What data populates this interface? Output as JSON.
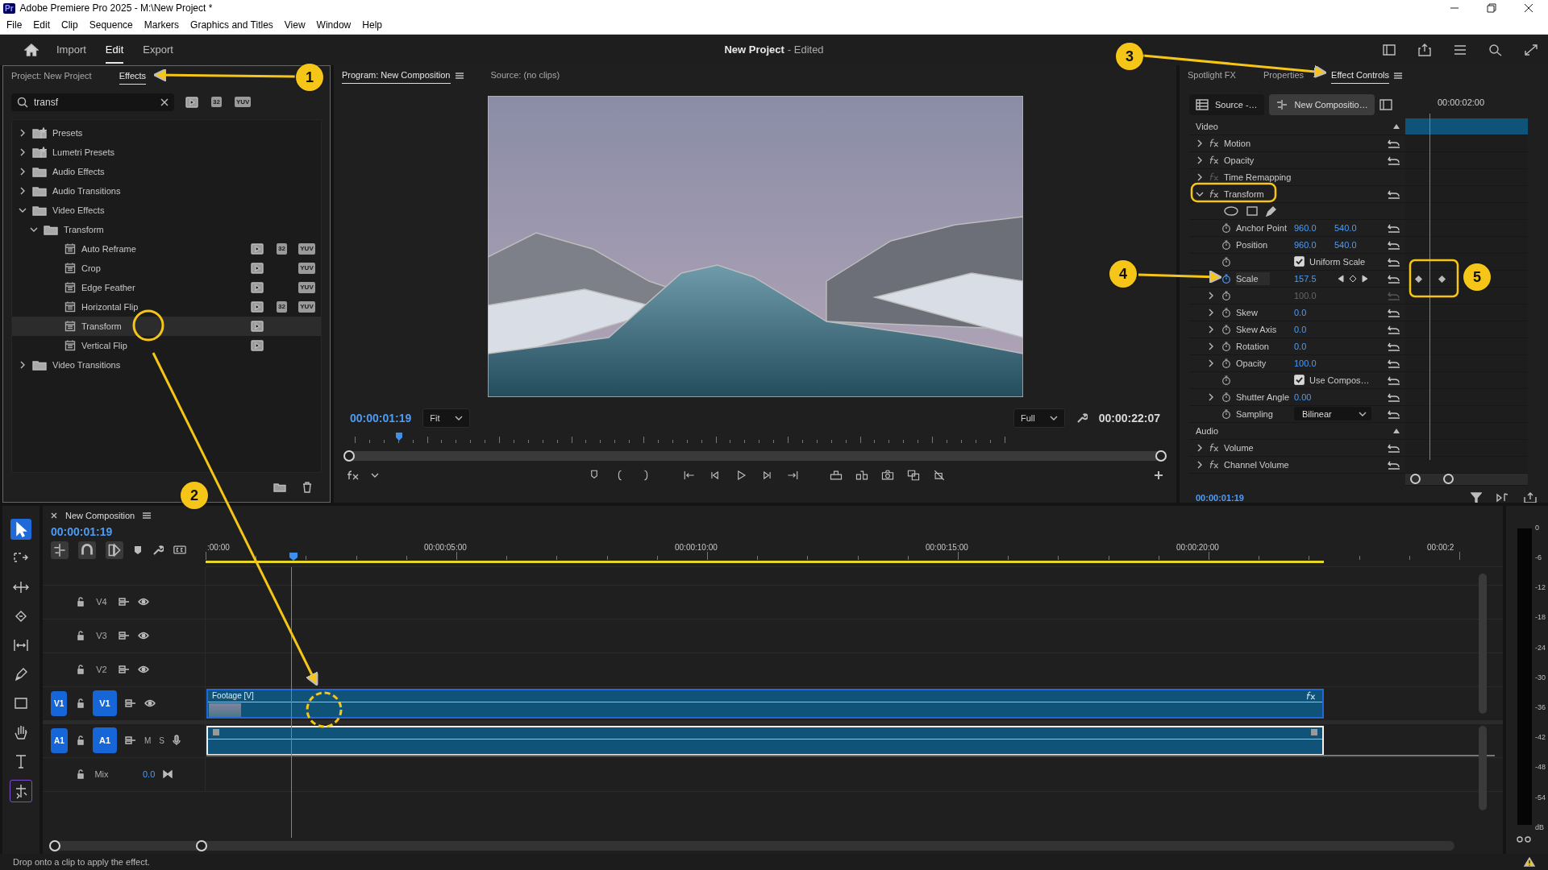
{
  "window": {
    "app_badge": "Pr",
    "title": "Adobe Premiere Pro 2025 - M:\\New Project *"
  },
  "menu": [
    "File",
    "Edit",
    "Clip",
    "Sequence",
    "Markers",
    "Graphics and Titles",
    "View",
    "Window",
    "Help"
  ],
  "header": {
    "tabs": [
      {
        "label": "Import",
        "selected": false
      },
      {
        "label": "Edit",
        "selected": true
      },
      {
        "label": "Export",
        "selected": false
      }
    ],
    "project_name": "New Project",
    "project_state": "- Edited"
  },
  "effects_panel": {
    "tabs": [
      {
        "label": "Project: New Project",
        "selected": false
      },
      {
        "label": "Effects",
        "selected": true
      }
    ],
    "search": {
      "value": "transf"
    },
    "filters": [
      {
        "kind": "accelerated"
      },
      {
        "kind": "bit32",
        "label": "32"
      },
      {
        "kind": "yuv",
        "label": "YUV"
      }
    ],
    "tree": [
      {
        "label": "Presets",
        "kind": "preset-bin",
        "expanded": false
      },
      {
        "label": "Lumetri Presets",
        "kind": "preset-bin",
        "expanded": false
      },
      {
        "label": "Audio Effects",
        "kind": "bin",
        "expanded": false
      },
      {
        "label": "Audio Transitions",
        "kind": "bin",
        "expanded": false
      },
      {
        "label": "Video Effects",
        "kind": "bin",
        "expanded": true,
        "children": [
          {
            "label": "Transform",
            "kind": "bin",
            "expanded": true,
            "children": [
              {
                "label": "Auto Reframe",
                "kind": "effect",
                "selected": false,
                "badges": [
                  {
                    "kind": "accelerated"
                  },
                  {
                    "kind": "bit32",
                    "label": "32"
                  },
                  {
                    "kind": "yuv",
                    "label": "YUV"
                  }
                ]
              },
              {
                "label": "Crop",
                "kind": "effect",
                "selected": false,
                "badges": [
                  {
                    "kind": "accelerated"
                  },
                  {
                    "kind": "yuv",
                    "label": "YUV"
                  }
                ]
              },
              {
                "label": "Edge Feather",
                "kind": "effect",
                "selected": false,
                "badges": [
                  {
                    "kind": "accelerated"
                  },
                  {
                    "kind": "yuv",
                    "label": "YUV"
                  }
                ]
              },
              {
                "label": "Horizontal Flip",
                "kind": "effect",
                "selected": false,
                "badges": [
                  {
                    "kind": "accelerated"
                  },
                  {
                    "kind": "bit32",
                    "label": "32"
                  },
                  {
                    "kind": "yuv",
                    "label": "YUV"
                  }
                ]
              },
              {
                "label": "Transform",
                "kind": "effect",
                "selected": true,
                "badges": [
                  {
                    "kind": "accelerated"
                  }
                ]
              },
              {
                "label": "Vertical Flip",
                "kind": "effect",
                "selected": false,
                "badges": [
                  {
                    "kind": "accelerated"
                  }
                ]
              }
            ]
          }
        ]
      },
      {
        "label": "Video Transitions",
        "kind": "bin",
        "expanded": false
      }
    ]
  },
  "program_monitor": {
    "tabs": [
      {
        "label": "Program: New Composition",
        "selected": true
      },
      {
        "label": "Source: (no clips)",
        "selected": false
      }
    ],
    "timecode": "00:00:01:19",
    "zoom": "Fit",
    "quality": "Full",
    "duration": "00:00:22:07"
  },
  "effect_controls": {
    "tabs": [
      {
        "label": "Spotlight FX",
        "selected": false
      },
      {
        "label": "Properties",
        "selected": false
      },
      {
        "label": "Effect Controls",
        "selected": true
      }
    ],
    "source": "Source -…",
    "clip": "New Compositio…",
    "ruler_time": "00:00:02:00",
    "current_time": "00:00:01:19",
    "sections": [
      {
        "label": "Video",
        "effects": [
          {
            "label": "Motion",
            "enabled": true,
            "expanded": false
          },
          {
            "label": "Opacity",
            "enabled": true,
            "expanded": false
          },
          {
            "label": "Time Remapping",
            "enabled": false,
            "expanded": false
          },
          {
            "label": "Transform",
            "enabled": true,
            "expanded": true,
            "properties": [
              {
                "kind": "shapes"
              },
              {
                "kind": "number",
                "label": "Anchor Point",
                "values": [
                  "960.0",
                  "540.0"
                ],
                "expandable": false,
                "animated": false,
                "disabled": false
              },
              {
                "kind": "number",
                "label": "Position",
                "values": [
                  "960.0",
                  "540.0"
                ],
                "expandable": false,
                "animated": false,
                "disabled": false
              },
              {
                "kind": "checkbox",
                "label": "Uniform Scale",
                "checked": true
              },
              {
                "kind": "number",
                "label": "Scale",
                "values": [
                  "157.5"
                ],
                "expandable": false,
                "animated": true,
                "disabled": false,
                "keyframes": [
                  {
                    "selected": false
                  },
                  {
                    "selected": false
                  }
                ]
              },
              {
                "kind": "number",
                "values": [
                  "100.0"
                ],
                "expandable": true,
                "animated": false,
                "disabled": true
              },
              {
                "kind": "number",
                "label": "Skew",
                "values": [
                  "0.0"
                ],
                "expandable": true,
                "animated": false,
                "disabled": false
              },
              {
                "kind": "number",
                "label": "Skew Axis",
                "values": [
                  "0.0"
                ],
                "expandable": true,
                "animated": false,
                "disabled": false
              },
              {
                "kind": "number",
                "label": "Rotation",
                "values": [
                  "0.0"
                ],
                "expandable": true,
                "animated": false,
                "disabled": false
              },
              {
                "kind": "number",
                "label": "Opacity",
                "values": [
                  "100.0"
                ],
                "expandable": true,
                "animated": false,
                "disabled": false
              },
              {
                "kind": "checkbox",
                "label": "Use Compos…",
                "checked": true
              },
              {
                "kind": "number",
                "label": "Shutter Angle",
                "values": [
                  "0.00"
                ],
                "expandable": true,
                "animated": false,
                "disabled": false
              },
              {
                "kind": "dropdown",
                "label": "Sampling",
                "value": "Bilinear"
              }
            ]
          }
        ]
      },
      {
        "label": "Audio",
        "effects": [
          {
            "label": "Volume",
            "enabled": true,
            "expanded": false
          },
          {
            "label": "Channel Volume",
            "enabled": true,
            "expanded": false
          }
        ]
      }
    ]
  },
  "tools": [
    {
      "kind": "select",
      "selected": true
    },
    {
      "kind": "track-select",
      "selected": false
    },
    {
      "kind": "ripple",
      "selected": false
    },
    {
      "kind": "razor",
      "selected": false
    },
    {
      "kind": "slip",
      "selected": false
    },
    {
      "kind": "pen",
      "selected": false
    },
    {
      "kind": "rectangle",
      "selected": false
    },
    {
      "kind": "hand",
      "selected": false
    },
    {
      "kind": "type",
      "selected": false
    },
    {
      "kind": "generative",
      "selected": false
    }
  ],
  "timeline": {
    "title": "New Composition",
    "timecode": "00:00:01:19",
    "ruler": [
      ":00:00",
      "00:00:05:00",
      "00:00:10:00",
      "00:00:15:00",
      "00:00:20:00",
      "00:00:2"
    ],
    "tracks": [
      {
        "kind": "video",
        "label": "V4",
        "targeted": false
      },
      {
        "kind": "video",
        "label": "V3",
        "targeted": false
      },
      {
        "kind": "video",
        "label": "V2",
        "targeted": false
      },
      {
        "kind": "video",
        "label": "V1",
        "targeted": true,
        "source_patch": "V1",
        "clip": {
          "label": "Footage [V]",
          "has_effect": true
        }
      },
      {
        "kind": "audio",
        "label": "A1",
        "targeted": true,
        "source_patch": "A1",
        "mute": "M",
        "solo": "S",
        "clip": {
          "has_effect": false
        }
      },
      {
        "kind": "mix",
        "label": "Mix",
        "value": "0.0"
      }
    ]
  },
  "meter": {
    "scale": [
      "0",
      "-6",
      "-12",
      "-18",
      "-24",
      "-30",
      "-36",
      "-42",
      "-48",
      "-54",
      "dB"
    ]
  },
  "status": "Drop onto a clip to apply the effect.",
  "callouts": [
    {
      "label": "1"
    },
    {
      "label": "2"
    },
    {
      "label": "3"
    },
    {
      "label": "4"
    },
    {
      "label": "5"
    }
  ]
}
